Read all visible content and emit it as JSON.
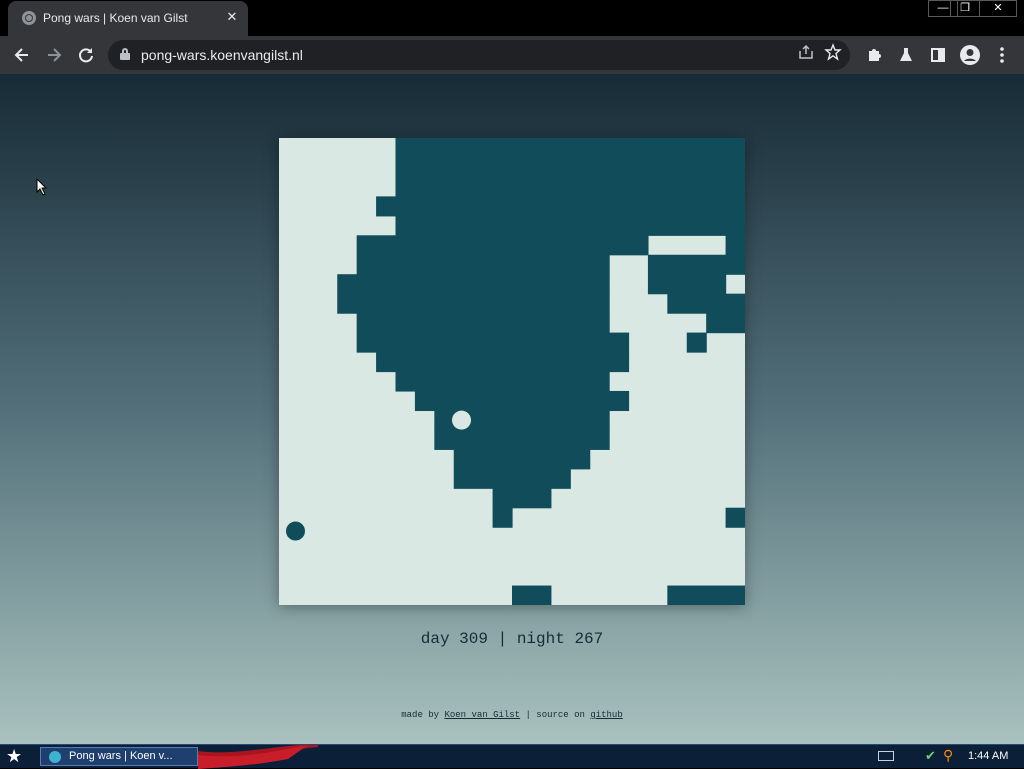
{
  "browser": {
    "tab_title": "Pong wars | Koen van Gilst",
    "tab_close": "✕",
    "url": "pong-wars.koenvangilst.nl",
    "window_controls": {
      "minimize": "—",
      "restore": "❐",
      "close": "✕"
    },
    "icons": [
      "back-arrow-icon",
      "forward-arrow-icon",
      "reload-icon",
      "lock-icon",
      "share-icon",
      "star-icon",
      "extensions-icon",
      "labs-icon",
      "side-panel-icon",
      "profile-icon",
      "menu-icon"
    ]
  },
  "page": {
    "score": {
      "day_label": "day",
      "day_value": "309",
      "separator": "|",
      "night_label": "night",
      "night_value": "267"
    },
    "credits": {
      "prefix": "made by",
      "author": "Koen van Gilst",
      "middle": "| source on",
      "source": "github"
    },
    "colors": {
      "day": "#d9e8e3",
      "night": "#114c5a"
    }
  },
  "game_board": {
    "grid_columns": 24,
    "grid_rows": 24,
    "night_rows": [
      "......##################",
      "......##################",
      "......##################",
      ".....###################",
      "......##################",
      ".....#############......",
      ".....###################",
      "....#####..............##",
      "...######..............##",
      "...######..............##",
      "...######..............##",
      "...######..............##",
      "...######..............##",
      "...######..............##",
      "...######..............##",
      "...######..............##",
      "...######..............##",
      "...######..............##",
      "...######..............##",
      "...######..............##",
      "...######..............##",
      "...######..............##",
      "...######..............##",
      "...######..............##"
    ],
    "night_cells": [
      [
        6,
        0,
        18,
        1
      ],
      [
        6,
        1,
        18,
        1
      ],
      [
        6,
        2,
        18,
        1
      ],
      [
        5,
        3,
        19,
        1
      ],
      [
        6,
        4,
        18,
        1
      ],
      [
        4,
        5,
        15,
        1
      ],
      [
        23,
        5,
        1,
        1
      ],
      [
        4,
        6,
        13,
        1
      ],
      [
        19,
        6,
        5,
        1
      ],
      [
        3,
        7,
        14,
        1
      ],
      [
        19,
        7,
        4,
        1
      ],
      [
        3,
        8,
        14,
        1
      ],
      [
        20,
        8,
        2,
        1
      ],
      [
        22,
        8,
        2,
        1
      ],
      [
        4,
        9,
        13,
        1
      ],
      [
        22,
        9,
        2,
        1
      ],
      [
        4,
        10,
        14,
        1
      ],
      [
        21,
        10,
        1,
        1
      ],
      [
        5,
        11,
        13,
        1
      ],
      [
        6,
        12,
        11,
        1
      ],
      [
        7,
        13,
        11,
        1
      ],
      [
        8,
        14,
        9,
        1
      ],
      [
        8,
        15,
        9,
        1
      ],
      [
        9,
        16,
        7,
        1
      ],
      [
        9,
        17,
        6,
        1
      ],
      [
        11,
        18,
        3,
        1
      ],
      [
        11,
        19,
        1,
        1
      ],
      [
        23,
        19,
        1,
        1
      ],
      [
        12,
        23,
        2,
        1
      ],
      [
        20,
        23,
        4,
        1
      ]
    ],
    "balls": [
      {
        "team": "day",
        "col": 9.4,
        "row": 14.5
      },
      {
        "team": "night",
        "col": 0.85,
        "row": 20.2
      }
    ]
  },
  "taskbar": {
    "start_glyph": "★",
    "task_label": "Pong wars | Koen v...",
    "clock": "1:44 AM"
  }
}
